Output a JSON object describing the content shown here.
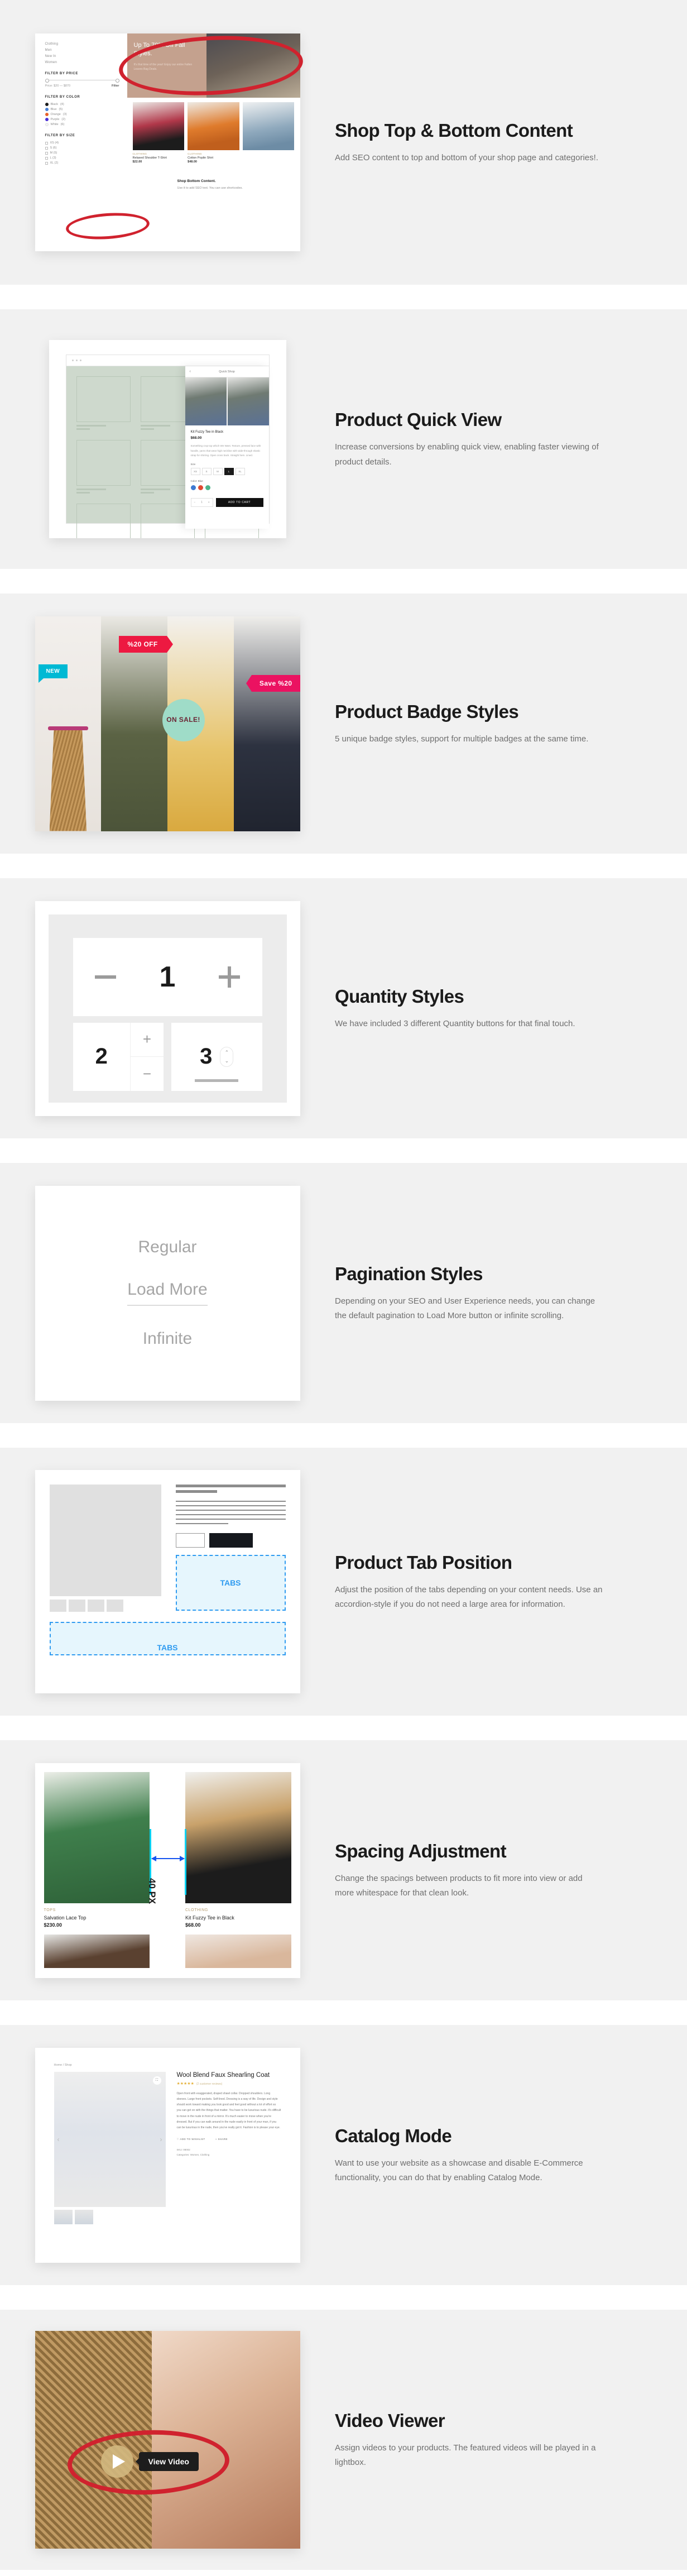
{
  "features": [
    {
      "title": "Shop Top & Bottom Content",
      "desc": "Add SEO content to top and bottom of your shop page and categories!.",
      "shot": {
        "sidebar_categories": [
          "Clothing",
          "Men",
          "New In",
          "Women"
        ],
        "filter_price_label": "FILTER BY PRICE",
        "price_range": "Price: $20 — $870",
        "filter_button": "Filter",
        "filter_color_label": "FILTER BY COLOR",
        "colors": [
          {
            "name": "Black",
            "count": "(4)",
            "hex": "#1b1b1b"
          },
          {
            "name": "Blue",
            "count": "(5)",
            "hex": "#4a7fd4"
          },
          {
            "name": "Orange",
            "count": "(3)",
            "hex": "#e8622a"
          },
          {
            "name": "Purple",
            "count": "(2)",
            "hex": "#4b2fd6"
          },
          {
            "name": "White",
            "count": "(6)",
            "hex": "#f4f4f4"
          }
        ],
        "filter_size_label": "FILTER BY SIZE",
        "sizes": [
          "XS (4)",
          "S (6)",
          "M (5)",
          "L (3)",
          "XL (2)"
        ],
        "hero_title": "Up To 70% Off Fall Styles.",
        "hero_sub": "It's that time of the year! Enjoy our entire Fallen Leaves Bag Deals.",
        "products": [
          {
            "cat": "CLOTHING",
            "name": "Relaxed Shoulder T-Shirt",
            "price": "$22.00"
          },
          {
            "cat": "CLOTHING",
            "name": "Cotton Poplin Shirt",
            "price": "$48.00"
          }
        ],
        "bottom_title": "Shop Bottom Content.",
        "bottom_text": "Use it to add SEO text. You can use shortcodes."
      }
    },
    {
      "title": "Product Quick View",
      "desc": "Increase conversions by enabling quick view, enabling faster viewing of product details.",
      "shot": {
        "panel_title": "Quick Shop",
        "product_name": "Kit Fuzzy Tee in Black",
        "product_price": "$68.00",
        "product_desc": "Something crop top which We Want. Texture, pressed lace with handle, yarns that wear high neckline with wide-through elastic strap for shirring. Open cross back. Straight hem. Lined.",
        "size_label": "Size",
        "sizes": [
          "XS",
          "S",
          "M",
          "L",
          "XL"
        ],
        "selected_size": "L",
        "color_label": "Color: Blue",
        "colors": [
          "#3f7ad1",
          "#e04a32",
          "#4eb58b"
        ],
        "qty_value": "1",
        "add_to_cart": "ADD TO CART"
      }
    },
    {
      "title": "Product Badge Styles",
      "desc": "5 unique badge styles, support for multiple badges at the same time.",
      "shot": {
        "badges": [
          {
            "label": "NEW",
            "color": "#00b9d4",
            "style": "ribbon-left"
          },
          {
            "label": "%20 OFF",
            "color": "#ed1941",
            "style": "flag-right"
          },
          {
            "label": "ON SALE!",
            "color": "#9fdcc8",
            "style": "circle"
          },
          {
            "label": "Save %20",
            "color": "#eb1261",
            "style": "flag-left"
          }
        ]
      }
    },
    {
      "title": "Quantity Styles",
      "desc": "We have included 3 different Quantity buttons for that final touch.",
      "shot": {
        "style1": {
          "minus": "−",
          "value": "1",
          "plus": "+"
        },
        "style2": {
          "value": "2",
          "plus": "+",
          "minus": "−"
        },
        "style3": {
          "value": "3",
          "up": "⌃",
          "down": "⌄"
        }
      }
    },
    {
      "title": "Pagination Styles",
      "desc": "Depending on your SEO and User Experience needs, you can change the default pagination to Load More button or infinite scrolling.",
      "shot": {
        "options": [
          "Regular",
          "Load More",
          "Infinite"
        ]
      }
    },
    {
      "title": "Product Tab Position",
      "desc": "Adjust the position of the tabs depending on your content needs. Use an accordion-style if you do not need a large area for information.",
      "shot": {
        "tab_label_side": "TABS",
        "tab_label_bottom": "TABS",
        "accent": "#2f9bf0"
      }
    },
    {
      "title": "Spacing Adjustment",
      "desc": "Change the spacings between products to fit more into view or add more whitespace for that clean look.",
      "shot": {
        "measure_label": "40 PX",
        "products": [
          {
            "cat": "TOPS",
            "name": "Salvation Lace Top",
            "price": "$230.00"
          },
          {
            "cat": "CLOTHING",
            "name": "Kit Fuzzy Tee in Black",
            "price": "$68.00"
          }
        ]
      }
    },
    {
      "title": "Catalog Mode",
      "desc": "Want to use your website as a showcase and disable E-Commerce functionality, you can do that by enabling Catalog Mode.",
      "shot": {
        "breadcrumb": "Home / Shop",
        "product_title": "Wool Blend Faux Shearling Coat",
        "stars": "★★★★★",
        "reviews": "(2 customer reviews)",
        "description": "Open front with exaggerated, draped shawl collar. Dropped shoulders. Long sleeves. Large front pockets. Self-lined. Dressing is a way of life. Design and style should work toward making you look good and feel good without a lot of effort so you can get on with the things that matter. You have to be luxurious nude. It's difficult to move in the nude in front of a mirror. It's much easier to move when you're dressed. But if you can walk around in the nude easily in front of your man, if you can be luxurious in the nude, then you've really got it. Fashion is to please your eye.",
        "wishlist": "ADD TO WISHLIST",
        "share": "SHARE",
        "sku": "SKU: 08002",
        "categories": "Categories: Women, Clothing"
      }
    },
    {
      "title": "Video Viewer",
      "desc": "Assign videos to your products. The featured videos will be played in a lightbox.",
      "shot": {
        "tooltip": "View Video",
        "play_icon": "play-triangle"
      }
    }
  ],
  "annotation_color": "#d0222e"
}
